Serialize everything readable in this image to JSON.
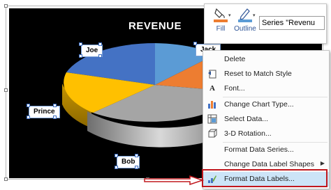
{
  "chart": {
    "title": "REVENUE",
    "labels": {
      "joe": "Joe",
      "jack": "Jack",
      "prince": "Prince",
      "bob": "Bob"
    },
    "colors": {
      "blue": "#4472c4",
      "light_blue": "#5b9bd5",
      "orange": "#ed7d31",
      "gray": "#a5a5a5",
      "yellow": "#ffc000",
      "background": "#000000"
    }
  },
  "toolbar": {
    "fill_label": "Fill",
    "outline_label": "Outline",
    "series_select_value": "Series \"Revenu",
    "fill_icon": "paint-bucket-icon",
    "outline_icon": "pen-outline-icon"
  },
  "context_menu": {
    "items": [
      {
        "label": "Delete",
        "icon": ""
      },
      {
        "label": "Reset to Match Style",
        "icon": "reset-style-icon"
      },
      {
        "label": "Font...",
        "icon": "font-icon"
      },
      {
        "label": "Change Chart Type...",
        "icon": "chart-type-icon"
      },
      {
        "label": "Select Data...",
        "icon": "select-data-icon"
      },
      {
        "label": "3-D Rotation...",
        "icon": "rotation-icon"
      },
      {
        "label": "Format Data Series...",
        "icon": ""
      },
      {
        "label": "Change Data Label Shapes",
        "icon": "",
        "submenu": true
      },
      {
        "label": "Format Data Labels...",
        "icon": "format-labels-icon",
        "highlighted": true
      }
    ]
  }
}
